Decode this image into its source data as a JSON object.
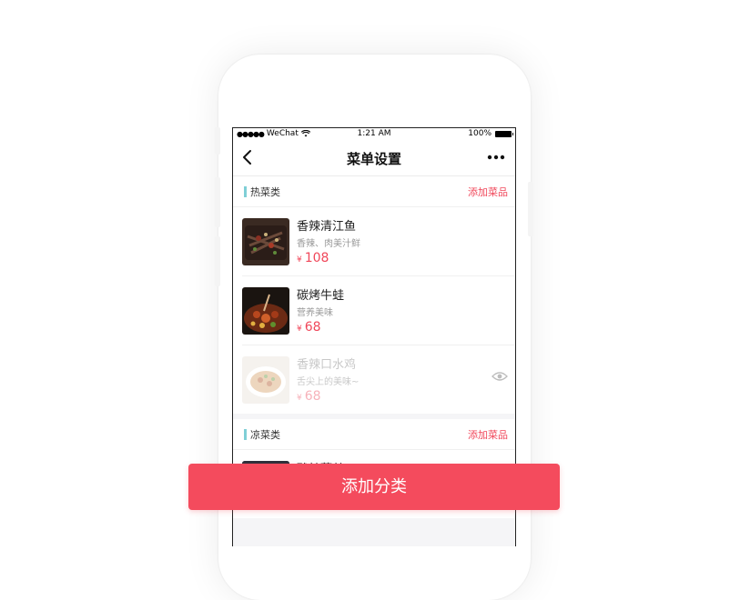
{
  "status_bar": {
    "carrier": "WeChat",
    "time": "1:21 AM",
    "battery": "100%"
  },
  "nav": {
    "title": "菜单设置"
  },
  "sections": [
    {
      "title": "热菜类",
      "add_label": "添加菜品",
      "dishes": [
        {
          "name": "香辣清江鱼",
          "desc": "香辣、肉美汁鲜",
          "currency": "¥",
          "price": "108",
          "hidden": false
        },
        {
          "name": "碳烤牛蛙",
          "desc": "营养美味",
          "currency": "¥",
          "price": "68",
          "hidden": false
        },
        {
          "name": "香辣口水鸡",
          "desc": "舌尖上的美味~",
          "currency": "¥",
          "price": "68",
          "hidden": true
        }
      ]
    },
    {
      "title": "凉菜类",
      "add_label": "添加菜品",
      "dishes": [
        {
          "name": "酸辣藕丝",
          "desc": "",
          "currency": "",
          "price": "",
          "hidden": false
        }
      ]
    }
  ],
  "footer": {
    "add_category_label": "添加分类"
  },
  "colors": {
    "accent": "#f44b5d",
    "section_marker": "#7fcfd6"
  },
  "icons": [
    "back-icon",
    "more-icon",
    "eye-icon",
    "wifi-icon",
    "battery-icon"
  ]
}
